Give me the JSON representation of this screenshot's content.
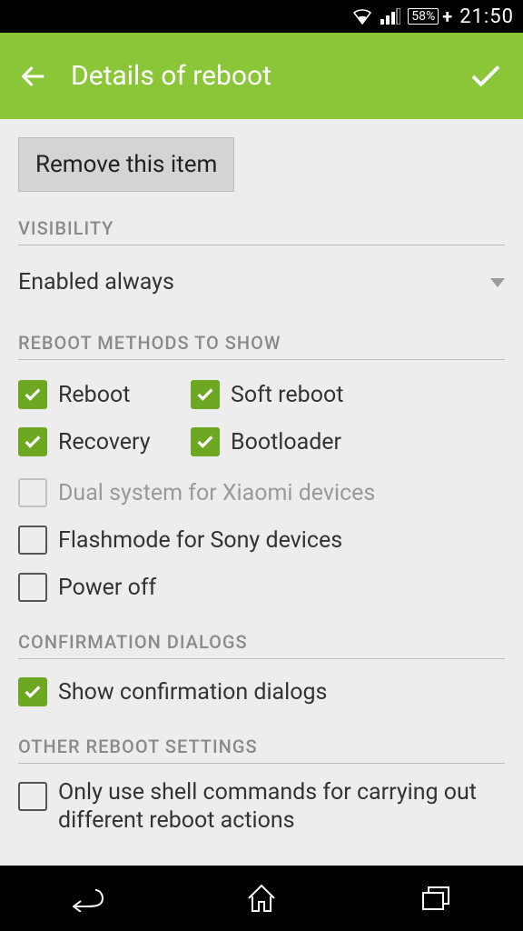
{
  "statusbar": {
    "battery": "58%",
    "time": "21:50"
  },
  "appbar": {
    "title": "Details of reboot"
  },
  "buttons": {
    "remove": "Remove this item"
  },
  "sections": {
    "visibility": "VISIBILITY",
    "methods": "REBOOT METHODS TO SHOW",
    "confirmation": "CONFIRMATION DIALOGS",
    "other": "OTHER REBOOT SETTINGS"
  },
  "visibility": {
    "selected": "Enabled always"
  },
  "methods": {
    "reboot": "Reboot",
    "soft": "Soft reboot",
    "recovery": "Recovery",
    "bootloader": "Bootloader",
    "dual": "Dual system for Xiaomi devices",
    "flashmode": "Flashmode for Sony devices",
    "poweroff": "Power off"
  },
  "confirmation": {
    "show": "Show confirmation dialogs"
  },
  "other": {
    "shell": "Only use shell commands for carrying out different reboot actions"
  }
}
